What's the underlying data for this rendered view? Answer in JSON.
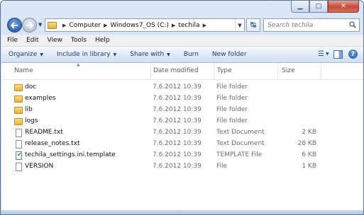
{
  "window": {
    "minimize_glyph": "▁",
    "maximize_glyph": "□",
    "close_glyph": "✕"
  },
  "navigation": {
    "back_icon": "back-arrow-icon",
    "forward_icon": "forward-arrow-icon",
    "breadcrumb": [
      "Computer",
      "Windows7_OS (C:)",
      "techila"
    ],
    "search_placeholder": "Search techila"
  },
  "menubar": {
    "items": [
      "File",
      "Edit",
      "View",
      "Tools",
      "Help"
    ]
  },
  "commandbar": {
    "organize": "Organize",
    "include_in_library": "Include in library",
    "share_with": "Share with",
    "burn": "Burn",
    "new_folder": "New folder"
  },
  "columns": {
    "name": "Name",
    "date_modified": "Date modified",
    "type": "Type",
    "size": "Size"
  },
  "files": [
    {
      "name": "doc",
      "date": "7.6.2012 10:39",
      "type": "File folder",
      "size": "",
      "icon": "folder-icon"
    },
    {
      "name": "examples",
      "date": "7.6.2012 10:39",
      "type": "File folder",
      "size": "",
      "icon": "folder-icon"
    },
    {
      "name": "lib",
      "date": "7.6.2012 10:39",
      "type": "File folder",
      "size": "",
      "icon": "folder-icon"
    },
    {
      "name": "logs",
      "date": "7.6.2012 10:39",
      "type": "File folder",
      "size": "",
      "icon": "folder-icon"
    },
    {
      "name": "README.txt",
      "date": "7.6.2012 10:39",
      "type": "Text Document",
      "size": "2 KB",
      "icon": "text-document-icon"
    },
    {
      "name": "release_notes.txt",
      "date": "7.6.2012 10:39",
      "type": "Text Document",
      "size": "28 KB",
      "icon": "text-document-icon"
    },
    {
      "name": "techila_settings.ini.template",
      "date": "7.6.2012 10:39",
      "type": "TEMPLATE File",
      "size": "6 KB",
      "icon": "template-file-icon"
    },
    {
      "name": "VERSION",
      "date": "7.6.2012 10:39",
      "type": "File",
      "size": "1 KB",
      "icon": "file-icon"
    }
  ],
  "colors": {
    "accent": "#1e395b",
    "frame": "#c6d8ee",
    "secondary_text": "#6d6d6d"
  }
}
